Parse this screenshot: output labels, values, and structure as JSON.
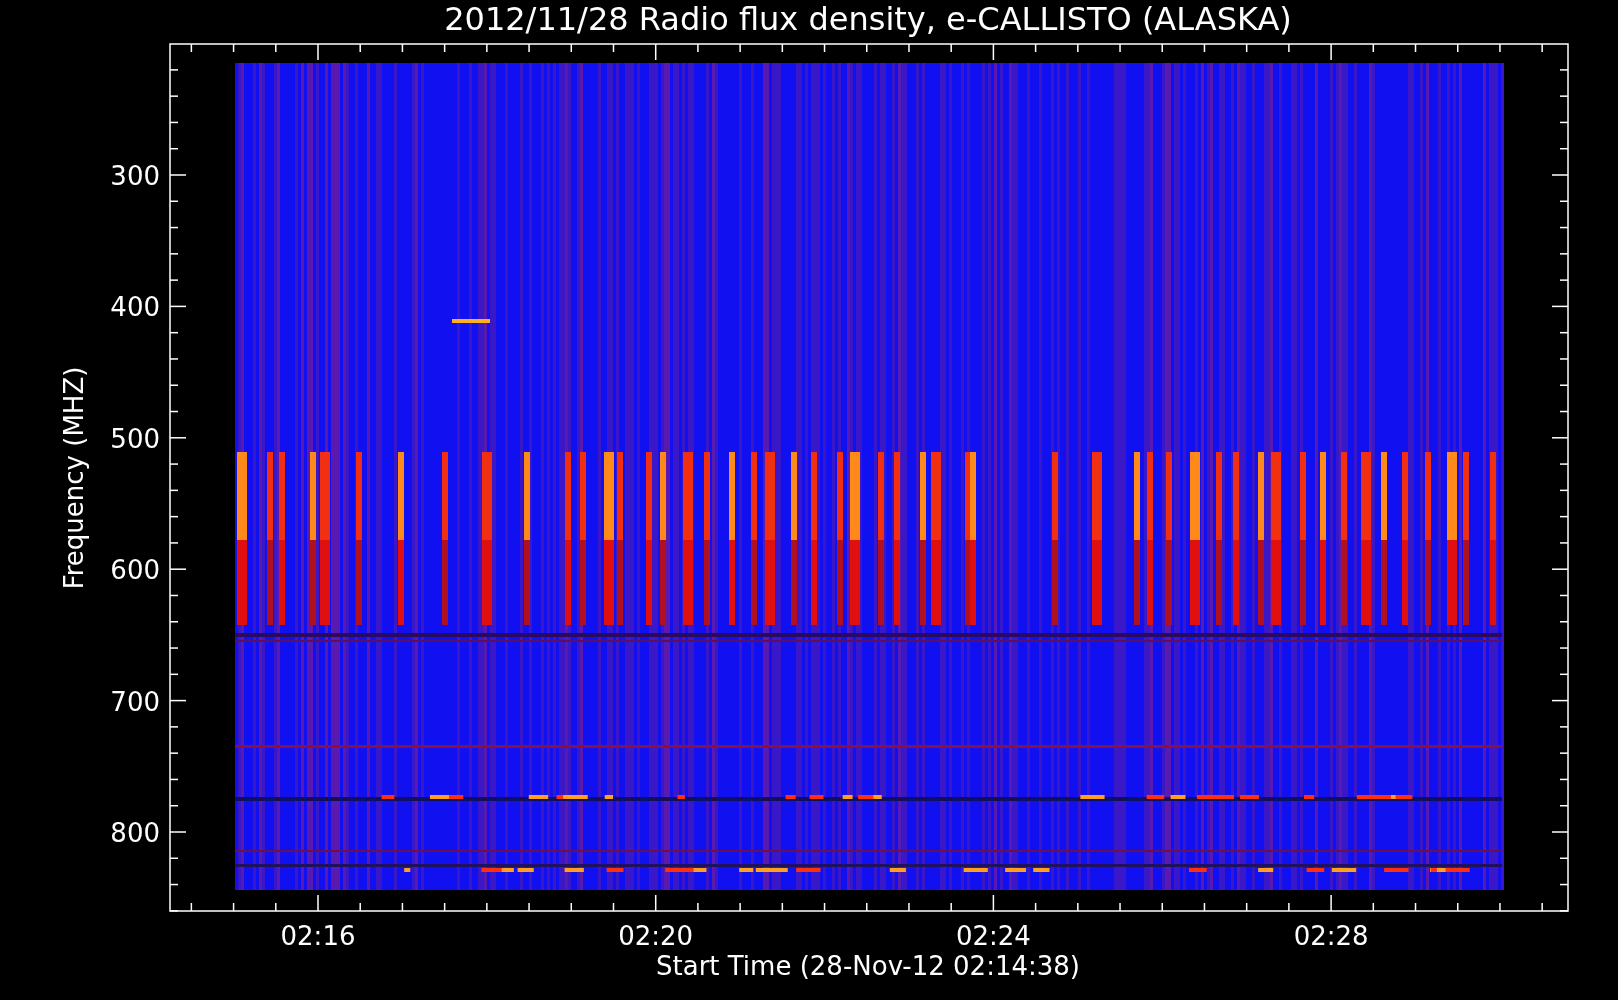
{
  "title": "2012/11/28  Radio flux density, e-CALLISTO (ALASKA)",
  "y_axis": {
    "label": "Frequency (MHZ)",
    "ticks": [
      "300",
      "400",
      "500",
      "600",
      "700",
      "800"
    ]
  },
  "x_axis": {
    "label": "Start Time (28-Nov-12 02:14:38)",
    "ticks": [
      "02:16",
      "02:20",
      "02:24",
      "02:28"
    ]
  }
}
